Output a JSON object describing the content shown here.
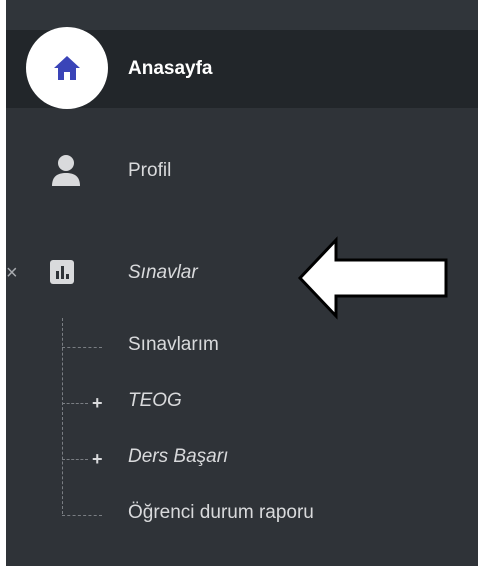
{
  "menu": {
    "home": {
      "label": "Anasayfa",
      "icon": "home-icon"
    },
    "profile": {
      "label": "Profil",
      "icon": "user-icon"
    },
    "exams": {
      "label": "Sınavlar",
      "icon": "bar-chart-icon",
      "collapse_symbol": "×",
      "children": [
        {
          "label": "Sınavlarım",
          "expandable": false
        },
        {
          "label": "TEOG",
          "expandable": true,
          "expand_symbol": "+"
        },
        {
          "label": "Ders Başarı",
          "expandable": true,
          "expand_symbol": "+"
        },
        {
          "label": "Öğrenci durum raporu",
          "expandable": false
        }
      ]
    }
  },
  "colors": {
    "sidebar_bg": "#2f3338",
    "active_bg": "#22262a",
    "home_icon": "#3a44b8",
    "text": "#d9dadc",
    "icon": "#d9dadc"
  }
}
